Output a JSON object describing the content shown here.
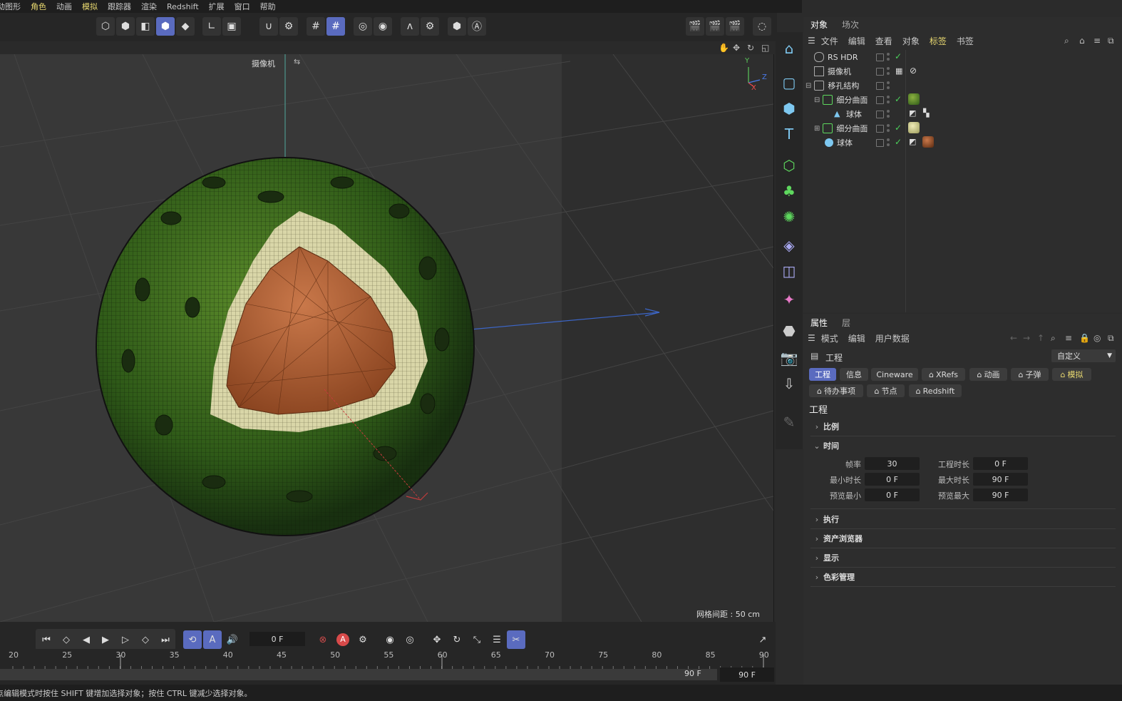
{
  "menu": [
    "动图形",
    "角色",
    "动画",
    "模拟",
    "跟踪器",
    "渲染",
    "Redshift",
    "扩展",
    "窗口",
    "帮助"
  ],
  "viewport": {
    "camera_label": "摄像机",
    "grid_spacing": "网格间距 : 50 cm",
    "axis_y": "Y",
    "axis_z": "Z",
    "axis_x": "X"
  },
  "object_manager": {
    "tabs": [
      "对象",
      "场次"
    ],
    "menu": [
      "文件",
      "编辑",
      "查看",
      "对象",
      "标签",
      "书签"
    ],
    "items": [
      {
        "label": "RS HDR",
        "icon": "environment-icon"
      },
      {
        "label": "摄像机",
        "icon": "camera-icon"
      },
      {
        "label": "移孔结构",
        "icon": "null-icon"
      },
      {
        "label": "细分曲面",
        "icon": "subdivision-icon"
      },
      {
        "label": "球体",
        "icon": "polygon-icon"
      },
      {
        "label": "细分曲面",
        "icon": "subdivision-icon"
      },
      {
        "label": "球体",
        "icon": "sphere-icon"
      }
    ]
  },
  "attributes": {
    "tabs": [
      "属性",
      "层"
    ],
    "menu": [
      "模式",
      "编辑",
      "用户数据"
    ],
    "object_label": "工程",
    "preset": "自定义",
    "pills_row1": [
      "工程",
      "信息",
      "Cineware",
      "XRefs",
      "动画",
      "子弹",
      "模拟"
    ],
    "pills_row2": [
      "待办事项",
      "节点",
      "Redshift"
    ],
    "section_title": "工程",
    "sections": [
      "比例",
      "时间",
      "执行",
      "资产浏览器",
      "显示",
      "色彩管理"
    ],
    "time_fields": {
      "fps_label": "帧率",
      "fps": "30",
      "project_len_label": "工程时长",
      "project_len": "0 F",
      "min_len_label": "最小时长",
      "min_len": "0 F",
      "max_len_label": "最大时长",
      "max_len": "90 F",
      "preview_min_label": "预览最小",
      "preview_min": "0 F",
      "preview_max_label": "预览最大",
      "preview_max": "90 F"
    }
  },
  "timeline": {
    "current_frame": "0 F",
    "ticks": [
      "20",
      "25",
      "30",
      "35",
      "40",
      "45",
      "50",
      "55",
      "60",
      "65",
      "70",
      "75",
      "80",
      "85",
      "90"
    ],
    "end_frame_a": "90 F",
    "end_frame_b": "90 F"
  },
  "status": "点编辑模式时按住 SHIFT 键增加选择对象；按住 CTRL 键减少选择对象。"
}
